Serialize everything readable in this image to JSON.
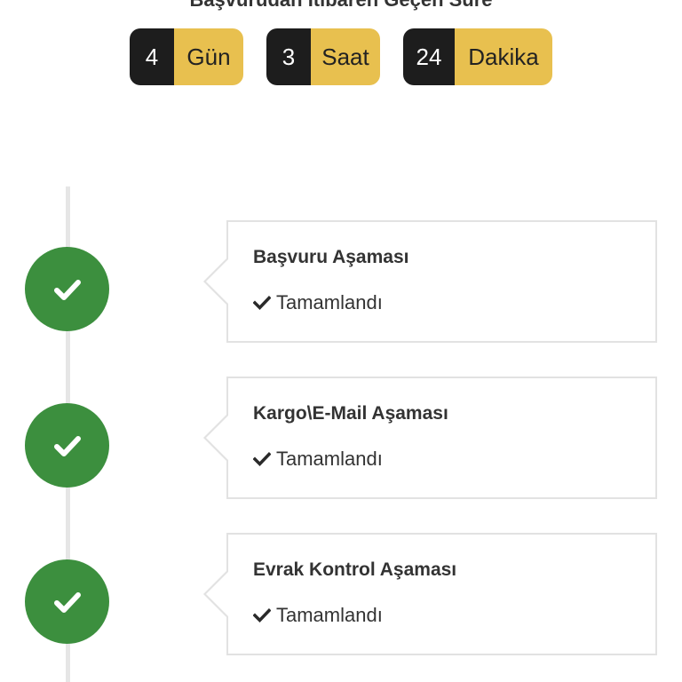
{
  "header": {
    "title": "Başvurudan İtibaren Geçen Süre"
  },
  "counters": [
    {
      "value": "4",
      "unit": "Gün"
    },
    {
      "value": "3",
      "unit": "Saat"
    },
    {
      "value": "24",
      "unit": "Dakika"
    }
  ],
  "steps": [
    {
      "title": "Başvuru Aşaması",
      "status": "Tamamlandı"
    },
    {
      "title": "Kargo\\E-Mail Aşaması",
      "status": "Tamamlandı"
    },
    {
      "title": "Evrak Kontrol Aşaması",
      "status": "Tamamlandı"
    }
  ],
  "colors": {
    "accent": "#e8c04f",
    "dark": "#1d1d1d",
    "success": "#3c8f3e"
  },
  "icons": {
    "step_icon": "check-icon",
    "status_icon": "check-icon"
  }
}
